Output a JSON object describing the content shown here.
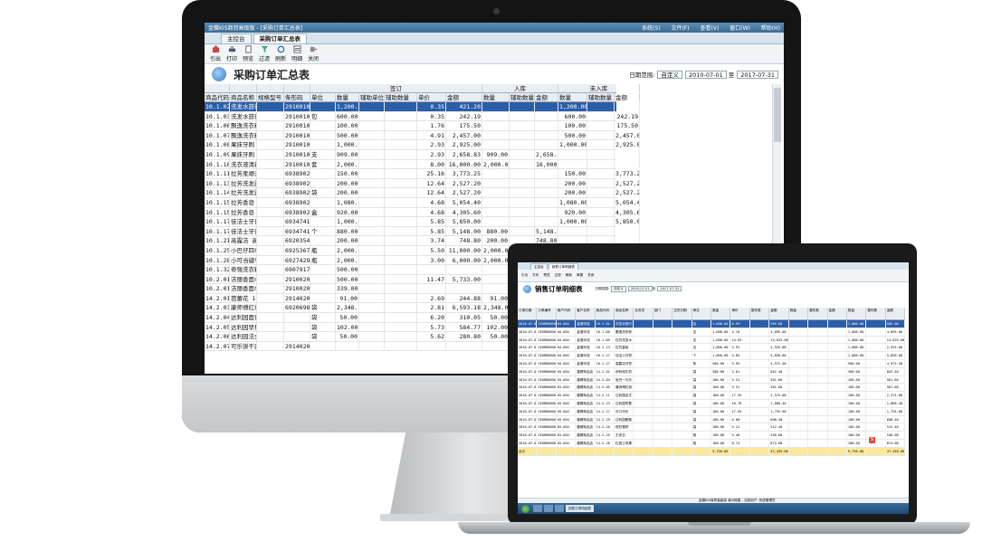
{
  "colors": {
    "accent": "#2b5ea8",
    "title_bar": "#3d6b90",
    "total_row": "#fbe89a"
  },
  "desktop": {
    "window_title": "金蝶KIS商贸高级版 - [采购订单汇总表]",
    "menu": [
      "系统(S)",
      "文件(F)",
      "查看(V)",
      "窗口(W)",
      "帮助(H)"
    ],
    "tabs": [
      "主控台",
      "采购订单汇总表"
    ],
    "toolbar": [
      "引出",
      "打印",
      "预览",
      "过滤",
      "刷新",
      "明细",
      "关闭"
    ],
    "report_title": "采购订单汇总表",
    "date_range": {
      "label": "日期范围:",
      "mode": "自定义",
      "start": "2010-07-01",
      "to": "至",
      "end": "2017-07-31"
    },
    "columns": [
      "商品代码",
      "商品名称",
      "规格型号",
      "条形码",
      "单位",
      "数量",
      "辅助单位",
      "辅助数量",
      "单价",
      "金额",
      "数量",
      "辅助数量",
      "金额",
      "数量",
      "辅助数量",
      "金额"
    ],
    "groups": {
      "order": "签订",
      "in": "入库",
      "not_in": "未入库"
    },
    "rows": [
      [
        "10.1.02",
        "洗发水旅行6x1",
        "",
        "2910010000",
        "",
        "1,200.00",
        "",
        "",
        "0.35",
        "421.20",
        "",
        "",
        "",
        "1,200.00",
        "",
        "421.20"
      ],
      [
        "10.1.03",
        "洗发水旅行6x1",
        "",
        "2910010000",
        "包",
        "600.00",
        "",
        "",
        "0.35",
        "242.19",
        "",
        "",
        "",
        "600.00",
        "",
        "242.19"
      ],
      [
        "10.1.06",
        "飘逸洗衣粉500g",
        "",
        "2910010000",
        "",
        "100.00",
        "",
        "",
        "1.76",
        "175.50",
        "",
        "",
        "",
        "100.00",
        "",
        "175.50"
      ],
      [
        "10.1.07",
        "飘逸洗衣粉2KG",
        "",
        "2910010000",
        "",
        "500.00",
        "",
        "",
        "4.91",
        "2,457.00",
        "",
        "",
        "",
        "500.00",
        "",
        "2,457.00"
      ],
      [
        "10.1.08",
        "果抹牙刷 100G",
        "",
        "2910010000",
        "",
        "1,000.00",
        "",
        "",
        "2.93",
        "2,925.00",
        "",
        "",
        "",
        "1,000.00",
        "",
        "2,925.00"
      ],
      [
        "10.1.09",
        "果抹牙刷 100G",
        "",
        "2910010000",
        "支",
        "909.00",
        "",
        "",
        "2.93",
        "2,658.83",
        "909.00",
        "",
        "2,658.83",
        "",
        "",
        ""
      ],
      [
        "10.1.10",
        "洗衣液清新牙刷、牙刷",
        "",
        "2910010000",
        "套",
        "2,000.00",
        "",
        "",
        "8.00",
        "16,000.00",
        "2,000.00",
        "",
        "16,000.00",
        "",
        "",
        ""
      ],
      [
        "10.1.11",
        "拉芳柔顺去屑香橙洗发水",
        "",
        "6938902610",
        "",
        "150.00",
        "",
        "",
        "25.16",
        "3,773.25",
        "",
        "",
        "",
        "150.00",
        "",
        "3,773.25"
      ],
      [
        "10.1.13",
        "拉芳洗发露强活香柔",
        "",
        "6938902610",
        "",
        "200.00",
        "",
        "",
        "12.64",
        "2,527.20",
        "",
        "",
        "",
        "200.00",
        "",
        "2,527.20"
      ],
      [
        "10.1.14",
        "拉芳洗发露强活香柔",
        "",
        "6938902610",
        "袋",
        "200.00",
        "",
        "",
        "12.64",
        "2,527.20",
        "",
        "",
        "",
        "200.00",
        "",
        "2,527.20"
      ],
      [
        "10.1.15",
        "拉芳香皂 草本罐装",
        "",
        "6938902610",
        "",
        "1,080.00",
        "",
        "",
        "4.68",
        "5,054.40",
        "",
        "",
        "",
        "1,080.00",
        "",
        "5,054.40"
      ],
      [
        "10.1.15",
        "拉芳香皂 草本罐装",
        "",
        "6938902610",
        "盒",
        "920.00",
        "",
        "",
        "4.68",
        "4,305.60",
        "",
        "",
        "",
        "920.00",
        "",
        "4,305.60"
      ],
      [
        "10.1.17",
        "佳洁士牙膏",
        "",
        "6934741700",
        "",
        "1,000.00",
        "",
        "",
        "5.85",
        "5,850.00",
        "",
        "",
        "",
        "1,000.00",
        "",
        "5,850.00"
      ],
      [
        "10.1.17",
        "佳洁士牙膏",
        "",
        "6934741700",
        "个",
        "880.00",
        "",
        "",
        "5.85",
        "5,148.00",
        "880.00",
        "",
        "5,148.00",
        "",
        "",
        ""
      ],
      [
        "10.1.21",
        "高露洁 高/40克",
        "",
        "6920354800",
        "",
        "200.00",
        "",
        "",
        "3.74",
        "748.80",
        "200.00",
        "",
        "748.80",
        "",
        "",
        ""
      ],
      [
        "10.1.25",
        "小巴仔四季芦荟水嫩",
        "",
        "6925367100",
        "瓶",
        "2,000.00",
        "",
        "",
        "5.50",
        "11,000.00",
        "2,000.00",
        "",
        "11,000.00",
        "",
        "",
        ""
      ],
      [
        "10.1.28",
        "小可当键牛奶+葡萄",
        "",
        "6927429200",
        "瓶",
        "2,000.00",
        "",
        "",
        "3.00",
        "6,000.00",
        "2,000.00",
        "",
        "6,000.00",
        "",
        "",
        ""
      ],
      [
        "10.1.32",
        "奇强洗衣粉300g",
        "",
        "6907917010",
        "",
        "500.00",
        "",
        "",
        "",
        "",
        "",
        "",
        "",
        "",
        "",
        ""
      ],
      [
        "10.2.01",
        "洁丽香面巾10个",
        "",
        "2910020000",
        "",
        "500.00",
        "",
        "",
        "11.47",
        "5,733.00",
        "",
        "",
        "",
        "",
        "",
        ""
      ],
      [
        "10.2.01",
        "洁丽香面巾10个",
        "",
        "2910020000",
        "",
        "339.00",
        "",
        "",
        "",
        "",
        "",
        "",
        "",
        "",
        "",
        ""
      ],
      [
        "14.2.01",
        "芭蕾花 10小袋+50",
        "",
        "2914020000",
        "",
        "91.00",
        "",
        "",
        "2.69",
        "244.88",
        "91.00",
        "",
        "",
        "",
        "",
        ""
      ],
      [
        "14.2.03",
        "康师傅红烧115g",
        "",
        "6920698490",
        "袋",
        "2,348.00",
        "",
        "",
        "2.81",
        "6,593.18",
        "2,348.00",
        "",
        "",
        "",
        "",
        ""
      ],
      [
        "14.2.04",
        "达利园面包300g",
        "",
        "",
        "袋",
        "50.00",
        "",
        "",
        "6.20",
        "310.05",
        "50.00",
        "",
        "",
        "",
        "",
        ""
      ],
      [
        "14.2.05",
        "达利园早餐面包250g",
        "",
        "",
        "袋",
        "102.00",
        "",
        "",
        "5.73",
        "584.77",
        "102.00",
        "",
        "",
        "",
        "",
        ""
      ],
      [
        "14.2.06",
        "达利园法式面包300g",
        "",
        "",
        "袋",
        "50.00",
        "",
        "",
        "5.62",
        "280.80",
        "50.00",
        "",
        "",
        "",
        "",
        ""
      ],
      [
        "14.2.07",
        "可乐饼干西瓜圆 可乐",
        "",
        "2914020000",
        "",
        "",
        "",
        "",
        "",
        "",
        "",
        "",
        "",
        "",
        "",
        ""
      ]
    ]
  },
  "laptop": {
    "tabs": [
      "主控台",
      "销售订单明细表"
    ],
    "toolbar": [
      "引出",
      "打印",
      "预览",
      "过滤",
      "刷新",
      "单据",
      "关闭"
    ],
    "report_title": "销售订单明细表",
    "date_range": {
      "label": "日期范围:",
      "mode": "自定义",
      "start": "2010-07-01",
      "to": "至",
      "end": "2017-07-31"
    },
    "columns": [
      "订单日期",
      "订单编号",
      "客户代码",
      "客户名称",
      "商品代码",
      "商品名称",
      "业务员",
      "部门",
      "交货日期",
      "单位",
      "数量",
      "单价",
      "整件数",
      "金额",
      "数量",
      "整件数",
      "金额",
      "数量",
      "整件数",
      "金额"
    ],
    "rows": [
      [
        "2010-07-01",
        "SEORD000001",
        "04.004",
        "金港河流",
        "10.1.02",
        "洗发水旅行",
        "",
        "",
        "",
        "包",
        "1,000.00",
        "0.59",
        "",
        "585.00",
        "",
        "",
        "",
        "1,000.00",
        "",
        "585.00"
      ],
      [
        "2010-07-01",
        "SEORD000001",
        "04.004",
        "金港河流",
        "10.1.06",
        "飘逸洗衣粉",
        "",
        "",
        "",
        "支",
        "1,000.00",
        "4.10",
        "",
        "4,095.00",
        "",
        "",
        "",
        "1,000.00",
        "",
        "4,095.00"
      ],
      [
        "2010-07-01",
        "SEORD000001",
        "04.004",
        "金港河流",
        "10.1.09",
        "拉芳洗发水",
        "",
        "",
        "",
        "支",
        "1,000.00",
        "14.63",
        "",
        "14,625.00",
        "",
        "",
        "",
        "1,000.00",
        "",
        "14,625.00"
      ],
      [
        "2010-07-01",
        "SEORD000001",
        "04.004",
        "金港河流",
        "10.1.13",
        "拉芳香皂",
        "",
        "",
        "",
        "支",
        "1,000.00",
        "2.93",
        "",
        "2,925.00",
        "",
        "",
        "",
        "1,000.00",
        "",
        "2,925.00"
      ],
      [
        "2010-07-01",
        "SEORD000001",
        "04.004",
        "金港河流",
        "10.1.17",
        "佳洁士牙膏",
        "",
        "",
        "",
        "个",
        "1,000.00",
        "5.85",
        "",
        "5,850.00",
        "",
        "",
        "",
        "1,000.00",
        "",
        "5,850.00"
      ],
      [
        "2010-07-01",
        "SEORD000001",
        "04.004",
        "金港河流",
        "10.1.17",
        "高露洁牙膏",
        "",
        "",
        "",
        "条",
        "500.00",
        "9.95",
        "",
        "4,972.50",
        "",
        "",
        "",
        "500.00",
        "",
        "4,972.50"
      ],
      [
        "2010-07-01",
        "SEORD000001",
        "05.004",
        "康健商品店",
        "14.2.01",
        "伊利纯牛奶",
        "",
        "",
        "",
        "袋",
        "300.00",
        "2.81",
        "",
        "842.40",
        "",
        "",
        "",
        "300.00",
        "",
        "842.40"
      ],
      [
        "2010-07-01",
        "SEORD000001",
        "05.004",
        "康健商品店",
        "14.2.04",
        "饭巴一元乐",
        "",
        "",
        "",
        "袋",
        "160.00",
        "3.51",
        "",
        "561.60",
        "",
        "",
        "",
        "160.00",
        "",
        "561.60"
      ],
      [
        "2010-07-01",
        "SEORD000001",
        "05.004",
        "康健商品店",
        "14.2.05",
        "康师傅红烧",
        "",
        "",
        "",
        "袋",
        "160.00",
        "3.51",
        "",
        "561.60",
        "",
        "",
        "",
        "160.00",
        "",
        "561.60"
      ],
      [
        "2010-07-01",
        "SEORD000001",
        "05.004",
        "康健商品店",
        "14.2.11",
        "达利园法式",
        "",
        "",
        "",
        "袋",
        "160.00",
        "17.55",
        "",
        "2,574.00",
        "",
        "",
        "",
        "100.00",
        "",
        "2,574.00"
      ],
      [
        "2010-07-01",
        "SEORD000001",
        "05.004",
        "康健商品店",
        "14.2.13",
        "达利园早餐",
        "",
        "",
        "",
        "袋",
        "160.00",
        "10.76",
        "",
        "1,860.40",
        "",
        "",
        "",
        "100.00",
        "",
        "1,860.40"
      ],
      [
        "2010-07-01",
        "SEORD000001",
        "05.004",
        "康健商品店",
        "14.2.17",
        "可口可乐",
        "",
        "",
        "",
        "袋",
        "160.00",
        "17.55",
        "",
        "1,755.00",
        "",
        "",
        "",
        "100.00",
        "",
        "1,755.00"
      ],
      [
        "2010-07-01",
        "SEORD000001",
        "05.004",
        "康健商品店",
        "14.2.19",
        "达利园蛋糕",
        "",
        "",
        "",
        "袋",
        "160.00",
        "6.08",
        "",
        "608.40",
        "",
        "",
        "",
        "100.00",
        "",
        "608.40"
      ],
      [
        "2010-07-01",
        "SEORD000001",
        "05.004",
        "康健商品店",
        "14.2.20",
        "旺旺雪饼",
        "",
        "",
        "",
        "袋",
        "160.00",
        "5.12",
        "",
        "512.40",
        "",
        "",
        "",
        "100.00",
        "",
        "512.40"
      ],
      [
        "2010-07-01",
        "SEORD000001",
        "05.004",
        "康健商品店",
        "14.2.25",
        "王老吉",
        "",
        "",
        "",
        "瓶",
        "160.00",
        "5.40",
        "",
        "540.00",
        "",
        "",
        "",
        "100.00",
        "",
        "540.00"
      ],
      [
        "2010-07-01",
        "SEORD000001",
        "05.004",
        "康健商品店",
        "14.2.28",
        "红富士苹果",
        "",
        "",
        "",
        "瓶",
        "160.00",
        "8.74",
        "",
        "874.00",
        "",
        "",
        "",
        "100.00",
        "",
        "874.00"
      ]
    ],
    "total": {
      "label": "合计",
      "qty": "5,750.00",
      "amount": "47,455.00",
      "qty2": "5,750.00",
      "amount2": "47,455.00"
    },
    "statusbar": "金蝶KIS商贸高级版 演示账套 - 当前用户: 系统管理员"
  }
}
